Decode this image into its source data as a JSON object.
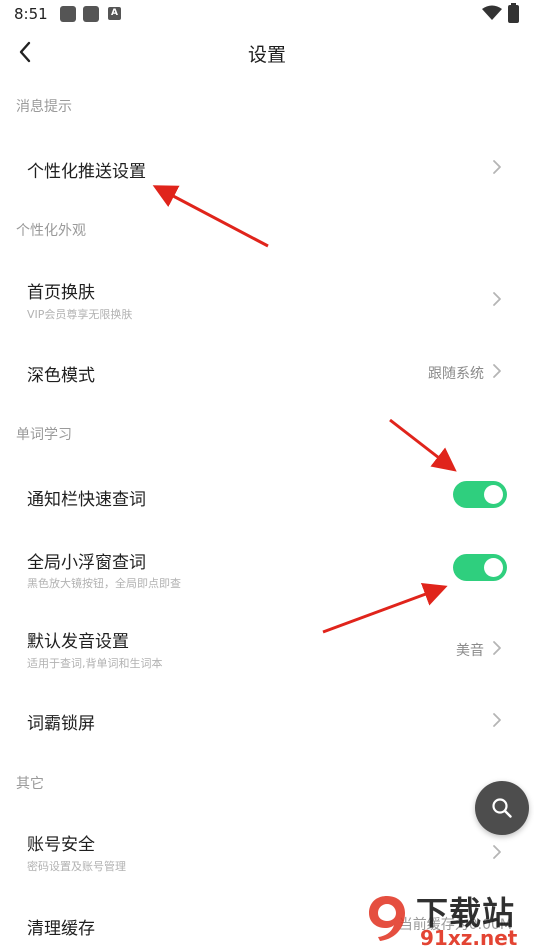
{
  "status_bar": {
    "time": "8:51",
    "app_icon_letter": "A"
  },
  "header": {
    "title": "设置"
  },
  "sections": {
    "notifications": {
      "title": "消息提示"
    },
    "appearance": {
      "title": "个性化外观"
    },
    "word_learning": {
      "title": "单词学习"
    },
    "other": {
      "title": "其它"
    }
  },
  "rows": {
    "push_settings": {
      "title": "个性化推送设置"
    },
    "skin": {
      "title": "首页换肤",
      "subtitle": "VIP会员尊享无限换肤"
    },
    "dark_mode": {
      "title": "深色模式",
      "value": "跟随系统"
    },
    "notify_lookup": {
      "title": "通知栏快速查词",
      "toggle_on": true
    },
    "float_lookup": {
      "title": "全局小浮窗查词",
      "subtitle": "黑色放大镜按钮，全局即点即查",
      "toggle_on": true
    },
    "pronunciation": {
      "title": "默认发音设置",
      "subtitle": "适用于查词,背单词和生词本",
      "value": "美音"
    },
    "lock_screen": {
      "title": "词霸锁屏"
    },
    "account": {
      "title": "账号安全",
      "subtitle": "密码设置及账号管理"
    },
    "cache": {
      "title": "清理缓存",
      "value": "当前缓存为0.00M"
    }
  },
  "watermark": {
    "logo": "9",
    "text": "下载站",
    "url": "91xz.net"
  },
  "colors": {
    "toggle_on": "#2fcf7e",
    "annotation_arrow": "#e0241b",
    "float_button": "#4d4d4d",
    "section_title": "#9a9a9a"
  },
  "icons": {
    "back": "chevron-left-icon",
    "row_arrow": "chevron-right-icon",
    "float": "search-icon"
  }
}
